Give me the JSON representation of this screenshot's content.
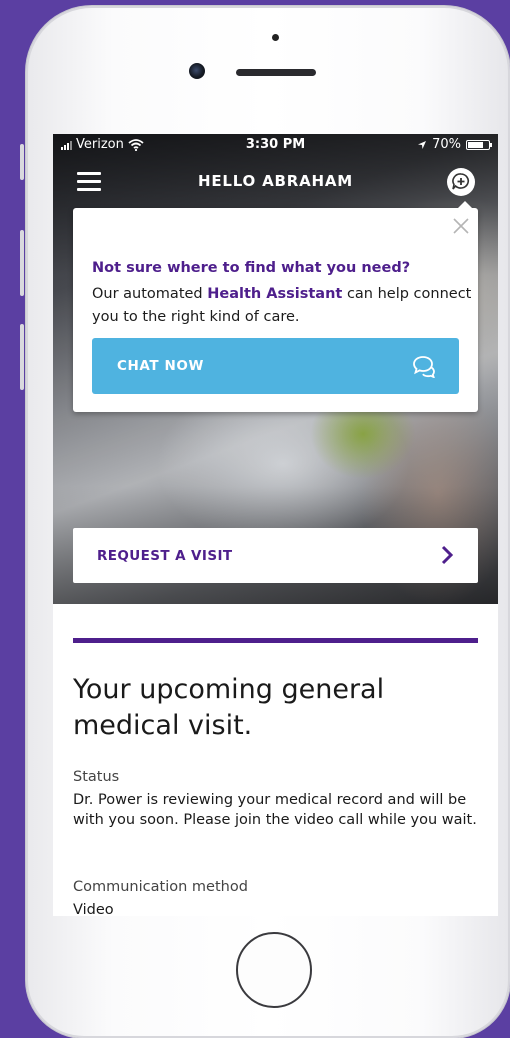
{
  "status_bar": {
    "carrier": "Verizon",
    "time": "3:30 PM",
    "battery": "70%"
  },
  "header": {
    "title": "HELLO ABRAHAM"
  },
  "popup": {
    "question": "Not sure where to find what you need?",
    "body_prefix": "Our automated ",
    "body_highlight": "Health Assistant",
    "body_suffix": " can help connect you to the right kind of care.",
    "chat_button_label": "CHAT NOW"
  },
  "request_visit": {
    "label": "REQUEST A VISIT"
  },
  "visit": {
    "title": "Your upcoming general medical visit.",
    "status_label": "Status",
    "status_text": "Dr. Power is reviewing your medical record and will be with you soon. Please join the video call while you wait.",
    "communication_label": "Communication method",
    "communication_value": "Video"
  },
  "colors": {
    "background": "#5b3fa2",
    "brand_purple": "#4e1f8c",
    "chat_blue": "#4fb3e0"
  },
  "icons": [
    "menu-icon",
    "chat-assistant-icon",
    "close-icon",
    "chat-bubbles-icon",
    "chevron-right-icon",
    "wifi-icon",
    "location-arrow-icon",
    "battery-icon"
  ]
}
